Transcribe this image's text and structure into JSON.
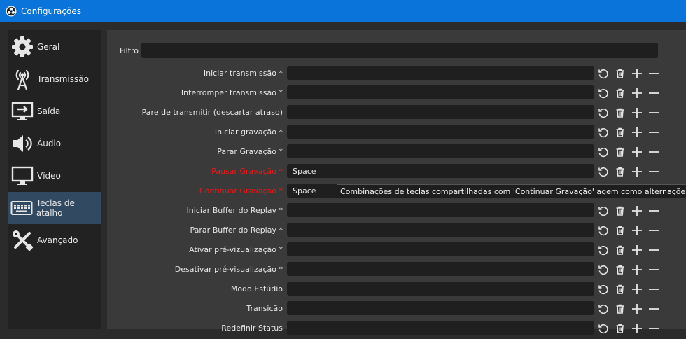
{
  "window": {
    "title": "Configurações"
  },
  "sidebar": {
    "items": [
      {
        "label": "Geral",
        "icon": "gear-icon"
      },
      {
        "label": "Transmissão",
        "icon": "broadcast-antenna-icon"
      },
      {
        "label": "Saída",
        "icon": "output-monitor-icon"
      },
      {
        "label": "Áudio",
        "icon": "speaker-icon"
      },
      {
        "label": "Vídeo",
        "icon": "monitor-icon"
      },
      {
        "label": "Teclas de atalho",
        "icon": "keyboard-icon",
        "active": true
      },
      {
        "label": "Avançado",
        "icon": "tools-icon"
      }
    ]
  },
  "filter": {
    "label": "Filtro",
    "value": ""
  },
  "hotkeys": [
    {
      "label": "Iniciar transmissão *",
      "value": "",
      "conflict": false
    },
    {
      "label": "Interromper transmissão *",
      "value": "",
      "conflict": false
    },
    {
      "label": "Pare de transmitir (descartar atraso)",
      "value": "",
      "conflict": false
    },
    {
      "label": "Iniciar gravação *",
      "value": "",
      "conflict": false
    },
    {
      "label": "Parar Gravação *",
      "value": "",
      "conflict": false
    },
    {
      "label": "Pausar Gravação *",
      "value": "Space",
      "conflict": true
    },
    {
      "label": "Continuar Gravação *",
      "value": "Space",
      "conflict": true
    },
    {
      "label": "Iniciar Buffer do Replay *",
      "value": "",
      "conflict": false
    },
    {
      "label": "Parar Buffer do Replay *",
      "value": "",
      "conflict": false
    },
    {
      "label": "Ativar pré-vizualização *",
      "value": "",
      "conflict": false
    },
    {
      "label": "Desativar pré-visualização *",
      "value": "",
      "conflict": false
    },
    {
      "label": "Modo Estúdio",
      "value": "",
      "conflict": false
    },
    {
      "label": "Transição",
      "value": "",
      "conflict": false
    },
    {
      "label": "Redefinir Status",
      "value": "",
      "conflict": false
    }
  ],
  "tooltip": {
    "text": "Combinações de teclas compartilhadas com 'Continuar Gravação' agem como alternações"
  },
  "colors": {
    "titlebar": "#0a74da",
    "conflict": "#e81919",
    "active_item": "#314a61"
  }
}
